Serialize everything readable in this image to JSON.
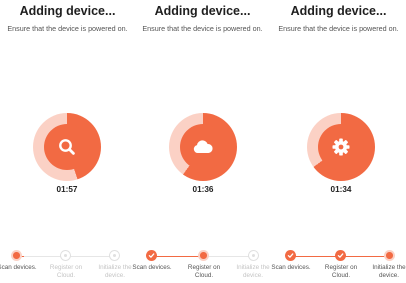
{
  "colors": {
    "accent": "#f26a43",
    "ring_light": "#fbd1c5",
    "inactive": "#e0e0e0"
  },
  "screens": [
    {
      "title": "Adding device...",
      "subtitle": "Ensure that the device is powered on.",
      "icon": "search-icon",
      "timer": "01:57",
      "progress": 0.45,
      "steps": [
        {
          "label": "Scan devices.",
          "state": "current"
        },
        {
          "label": "Register on Cloud.",
          "state": "inactive"
        },
        {
          "label": "Initialize the device.",
          "state": "inactive"
        }
      ]
    },
    {
      "title": "Adding device...",
      "subtitle": "Ensure that the device is powered on.",
      "icon": "cloud-icon",
      "timer": "01:36",
      "progress": 0.6,
      "steps": [
        {
          "label": "Scan devices.",
          "state": "done"
        },
        {
          "label": "Register on Cloud.",
          "state": "current"
        },
        {
          "label": "Initialize the device.",
          "state": "inactive"
        }
      ]
    },
    {
      "title": "Adding device...",
      "subtitle": "Ensure that the device is powered on.",
      "icon": "gear-icon",
      "timer": "01:34",
      "progress": 0.65,
      "steps": [
        {
          "label": "Scan devices.",
          "state": "done"
        },
        {
          "label": "Register on Cloud.",
          "state": "done"
        },
        {
          "label": "Initialize the device.",
          "state": "current"
        }
      ]
    }
  ]
}
